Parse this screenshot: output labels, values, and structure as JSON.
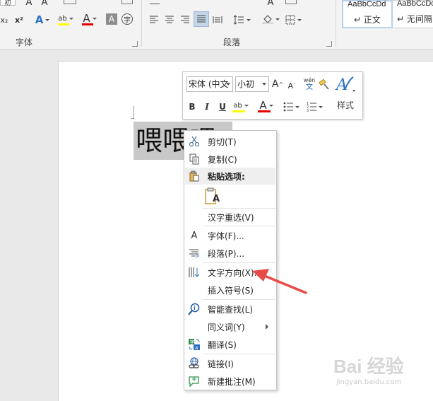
{
  "ribbon": {
    "font_group_label": "字体",
    "paragraph_group_label": "段落",
    "font_size_partial": "初",
    "char_shading_glyph": "A",
    "enclose_char_glyph": "字",
    "styles": [
      {
        "sample": "AaBbCcDd",
        "name": "正文"
      },
      {
        "sample": "AaBbCcDd",
        "name": "无间隔"
      }
    ],
    "colors": {
      "highlight": "#ffff00",
      "font_color": "#e00000",
      "selected_style_border": "#b9cfe8"
    }
  },
  "document": {
    "selected_text": "喂喂喂"
  },
  "mini_toolbar": {
    "font_name": "宋体 (中文",
    "font_size": "小初",
    "grow_font": "A",
    "shrink_font": "A",
    "pinyin_top": "wén",
    "pinyin_bottom": "文",
    "bold": "B",
    "italic": "I",
    "underline": "U",
    "styles_label": "样式"
  },
  "context_menu": {
    "items": [
      {
        "label": "剪切(T)",
        "icon": "scissors-icon"
      },
      {
        "label": "复制(C)",
        "icon": "copy-icon"
      },
      {
        "label": "粘贴选项:",
        "icon": "paste-icon"
      },
      {
        "label": "汉字重选(V)",
        "icon": ""
      },
      {
        "label": "字体(F)...",
        "icon": "font-icon"
      },
      {
        "label": "段落(P)...",
        "icon": "paragraph-icon"
      },
      {
        "label": "文字方向(X)...",
        "icon": "text-direction-icon"
      },
      {
        "label": "插入符号(S)",
        "icon": ""
      },
      {
        "label": "智能查找(L)",
        "icon": "smart-lookup-icon"
      },
      {
        "label": "同义词(Y)",
        "icon": ""
      },
      {
        "label": "翻译(S)",
        "icon": "translate-icon"
      },
      {
        "label": "链接(I)",
        "icon": "link-icon"
      },
      {
        "label": "新建批注(M)",
        "icon": "new-comment-icon"
      }
    ],
    "paste_keep_text_glyph": "A",
    "font_icon_glyph": "A"
  },
  "annotation": {
    "arrow_color": "#e84a4a"
  },
  "watermark": {
    "brand": "Bai 经验",
    "url": "jingyan.baidu.com"
  }
}
